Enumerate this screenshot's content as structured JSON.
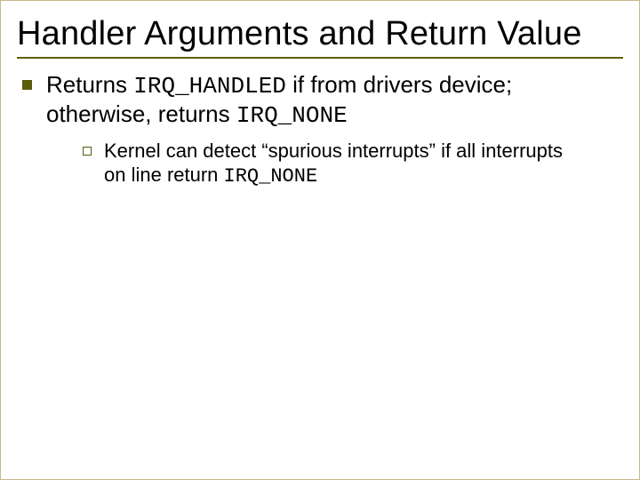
{
  "title": "Handler Arguments and Return Value",
  "p1": {
    "t1": "Returns ",
    "c1": "IRQ_HANDLED",
    "t2": " if from drivers device; otherwise, returns ",
    "c2": "IRQ_NONE"
  },
  "p2": {
    "t1": " Kernel can detect “spurious interrupts” if all interrupts on line return ",
    "c1": "IRQ_NONE"
  }
}
